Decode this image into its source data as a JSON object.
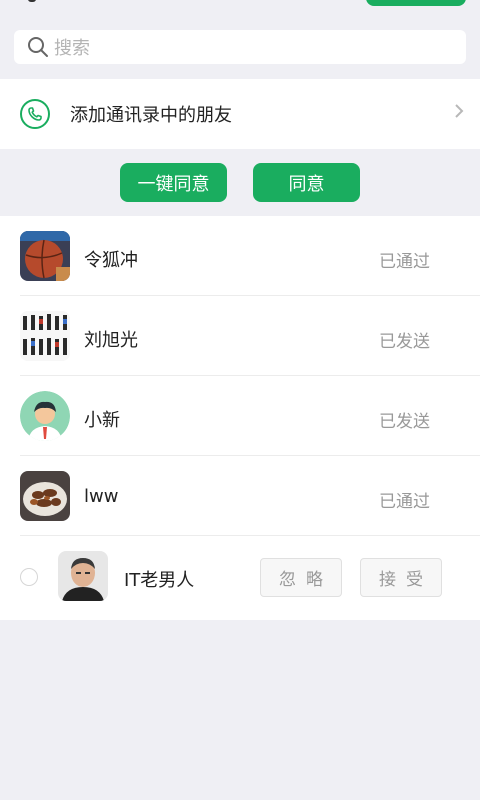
{
  "search": {
    "placeholder": "搜索",
    "icon": "search-icon"
  },
  "add_contact": {
    "label": "添加通讯录中的朋友",
    "icon": "phone-icon",
    "chevron": "chevron-right-icon"
  },
  "actions": {
    "accept_all": "一键同意",
    "accept": "同意"
  },
  "requests": [
    {
      "name": "令狐冲",
      "status": "已通过",
      "avatar": "basketball-photo"
    },
    {
      "name": "刘旭光",
      "status": "已发送",
      "avatar": "group-photo"
    },
    {
      "name": "小新",
      "status": "已发送",
      "avatar": "cartoon-man"
    },
    {
      "name": "lww",
      "status": "已通过",
      "avatar": "food-photo"
    },
    {
      "name": "IT老男人",
      "ignore": "忽略",
      "accept": "接受",
      "avatar": "portrait-photo"
    }
  ],
  "colors": {
    "accent": "#1aad5f",
    "background": "#efeff4",
    "status_text": "#999999"
  }
}
